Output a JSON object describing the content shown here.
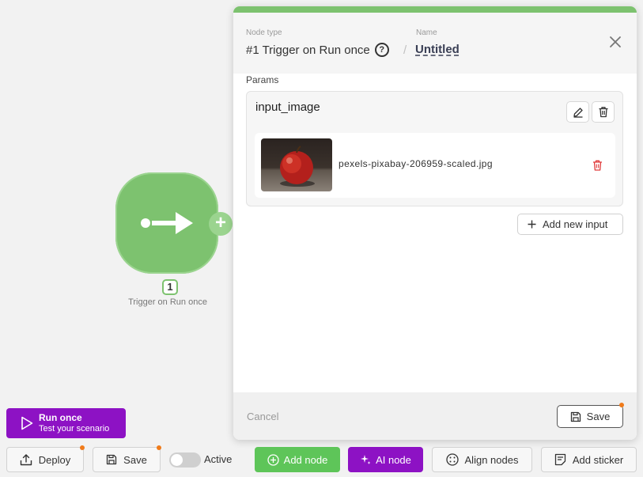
{
  "canvas": {
    "node": {
      "number": "1",
      "caption": "Trigger on Run once",
      "icon": "arrow-right-icon",
      "color": "#7dc26f"
    }
  },
  "panel": {
    "node_type_label": "Node type",
    "node_type_value": "#1 Trigger on Run once",
    "name_label": "Name",
    "name_value": "Untitled",
    "separator": "/",
    "params_label": "Params",
    "param": {
      "name": "input_image",
      "file_name": "pexels-pixabay-206959-scaled.jpg"
    },
    "add_input_label": "Add new input",
    "cancel_label": "Cancel",
    "save_label": "Save"
  },
  "toolbar": {
    "run_once_title": "Run once",
    "run_once_subtitle": "Test your scenario",
    "deploy_label": "Deploy",
    "save_label": "Save",
    "active_label": "Active",
    "active_on": false,
    "add_node_label": "Add node",
    "ai_node_label": "AI node",
    "align_nodes_label": "Align nodes",
    "add_sticker_label": "Add sticker"
  },
  "colors": {
    "accent_green": "#7dc26f",
    "button_green": "#5ec559",
    "purple": "#8d12c4",
    "notification_dot": "#f07b1a",
    "delete_red": "#e03a3a"
  }
}
